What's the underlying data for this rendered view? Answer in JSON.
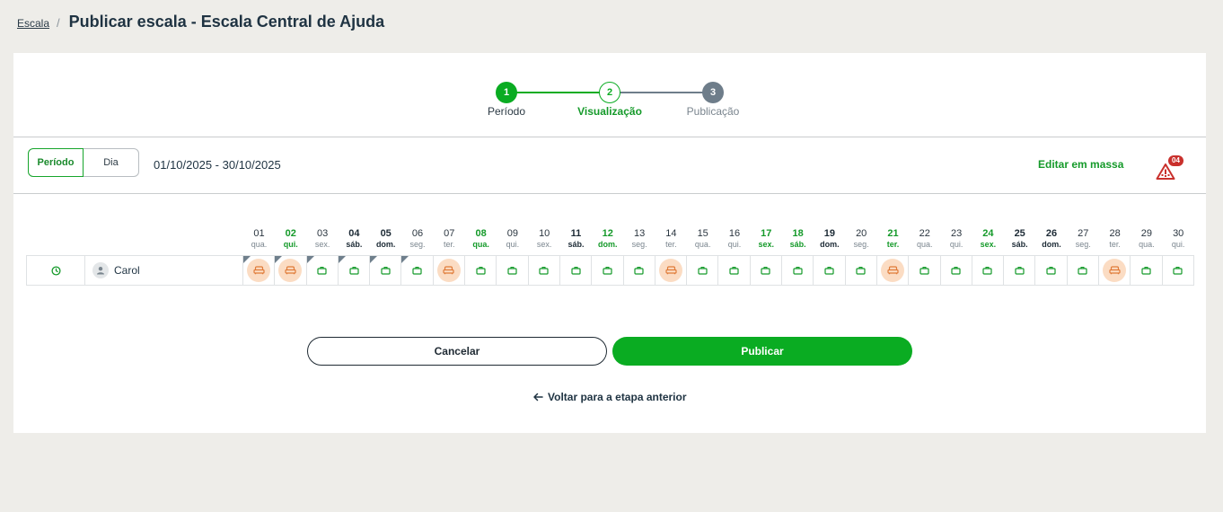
{
  "breadcrumb": {
    "link": "Escala",
    "separator": "/",
    "title": "Publicar escala - Escala Central de Ajuda"
  },
  "stepper": {
    "steps": [
      {
        "number": "1",
        "label": "Período",
        "state": "done"
      },
      {
        "number": "2",
        "label": "Visualização",
        "state": "current"
      },
      {
        "number": "3",
        "label": "Publicação",
        "state": "pending"
      }
    ]
  },
  "toolbar": {
    "view_modes": [
      "Período",
      "Dia"
    ],
    "selected_view": "Período",
    "range": "01/10/2025 - 30/10/2025",
    "mass_edit": "Editar em massa",
    "alert_count": "04"
  },
  "days": [
    {
      "num": "01",
      "wd": "qua.",
      "style": "normal",
      "shift": "off",
      "corner": true
    },
    {
      "num": "02",
      "wd": "qui.",
      "style": "green",
      "shift": "off",
      "corner": true
    },
    {
      "num": "03",
      "wd": "sex.",
      "style": "normal",
      "shift": "work",
      "corner": true
    },
    {
      "num": "04",
      "wd": "sáb.",
      "style": "bold",
      "shift": "work",
      "corner": true
    },
    {
      "num": "05",
      "wd": "dom.",
      "style": "bold",
      "shift": "work",
      "corner": true
    },
    {
      "num": "06",
      "wd": "seg.",
      "style": "normal",
      "shift": "work",
      "corner": true
    },
    {
      "num": "07",
      "wd": "ter.",
      "style": "normal",
      "shift": "off",
      "corner": false
    },
    {
      "num": "08",
      "wd": "qua.",
      "style": "green",
      "shift": "work",
      "corner": false
    },
    {
      "num": "09",
      "wd": "qui.",
      "style": "normal",
      "shift": "work",
      "corner": false
    },
    {
      "num": "10",
      "wd": "sex.",
      "style": "normal",
      "shift": "work",
      "corner": false
    },
    {
      "num": "11",
      "wd": "sáb.",
      "style": "bold",
      "shift": "work",
      "corner": false
    },
    {
      "num": "12",
      "wd": "dom.",
      "style": "green",
      "shift": "work",
      "corner": false
    },
    {
      "num": "13",
      "wd": "seg.",
      "style": "normal",
      "shift": "work",
      "corner": false
    },
    {
      "num": "14",
      "wd": "ter.",
      "style": "normal",
      "shift": "off",
      "corner": false
    },
    {
      "num": "15",
      "wd": "qua.",
      "style": "normal",
      "shift": "work",
      "corner": false
    },
    {
      "num": "16",
      "wd": "qui.",
      "style": "normal",
      "shift": "work",
      "corner": false
    },
    {
      "num": "17",
      "wd": "sex.",
      "style": "green",
      "shift": "work",
      "corner": false
    },
    {
      "num": "18",
      "wd": "sáb.",
      "style": "green",
      "shift": "work",
      "corner": false
    },
    {
      "num": "19",
      "wd": "dom.",
      "style": "bold",
      "shift": "work",
      "corner": false
    },
    {
      "num": "20",
      "wd": "seg.",
      "style": "normal",
      "shift": "work",
      "corner": false
    },
    {
      "num": "21",
      "wd": "ter.",
      "style": "green",
      "shift": "off",
      "corner": false
    },
    {
      "num": "22",
      "wd": "qua.",
      "style": "normal",
      "shift": "work",
      "corner": false
    },
    {
      "num": "23",
      "wd": "qui.",
      "style": "normal",
      "shift": "work",
      "corner": false
    },
    {
      "num": "24",
      "wd": "sex.",
      "style": "green",
      "shift": "work",
      "corner": false
    },
    {
      "num": "25",
      "wd": "sáb.",
      "style": "bold",
      "shift": "work",
      "corner": false
    },
    {
      "num": "26",
      "wd": "dom.",
      "style": "bold",
      "shift": "work",
      "corner": false
    },
    {
      "num": "27",
      "wd": "seg.",
      "style": "normal",
      "shift": "work",
      "corner": false
    },
    {
      "num": "28",
      "wd": "ter.",
      "style": "normal",
      "shift": "off",
      "corner": false
    },
    {
      "num": "29",
      "wd": "qua.",
      "style": "normal",
      "shift": "work",
      "corner": false
    },
    {
      "num": "30",
      "wd": "qui.",
      "style": "normal",
      "shift": "work",
      "corner": false
    }
  ],
  "employee": {
    "name": "Carol",
    "icon": "user-icon",
    "status_icon": "clock-icon"
  },
  "icons": {
    "work": "briefcase-icon",
    "off": "sofa-icon",
    "alert": "warning-triangle-icon",
    "back": "arrow-left-icon"
  },
  "colors": {
    "accent": "#0aac22",
    "green_text": "#159a2a",
    "off_bg": "#fbdcc3",
    "off_icon": "#e07b39",
    "pending_step": "#6e7d8a",
    "alert": "#c9302c"
  },
  "actions": {
    "cancel": "Cancelar",
    "publish": "Publicar",
    "back": "Voltar para a etapa anterior"
  }
}
